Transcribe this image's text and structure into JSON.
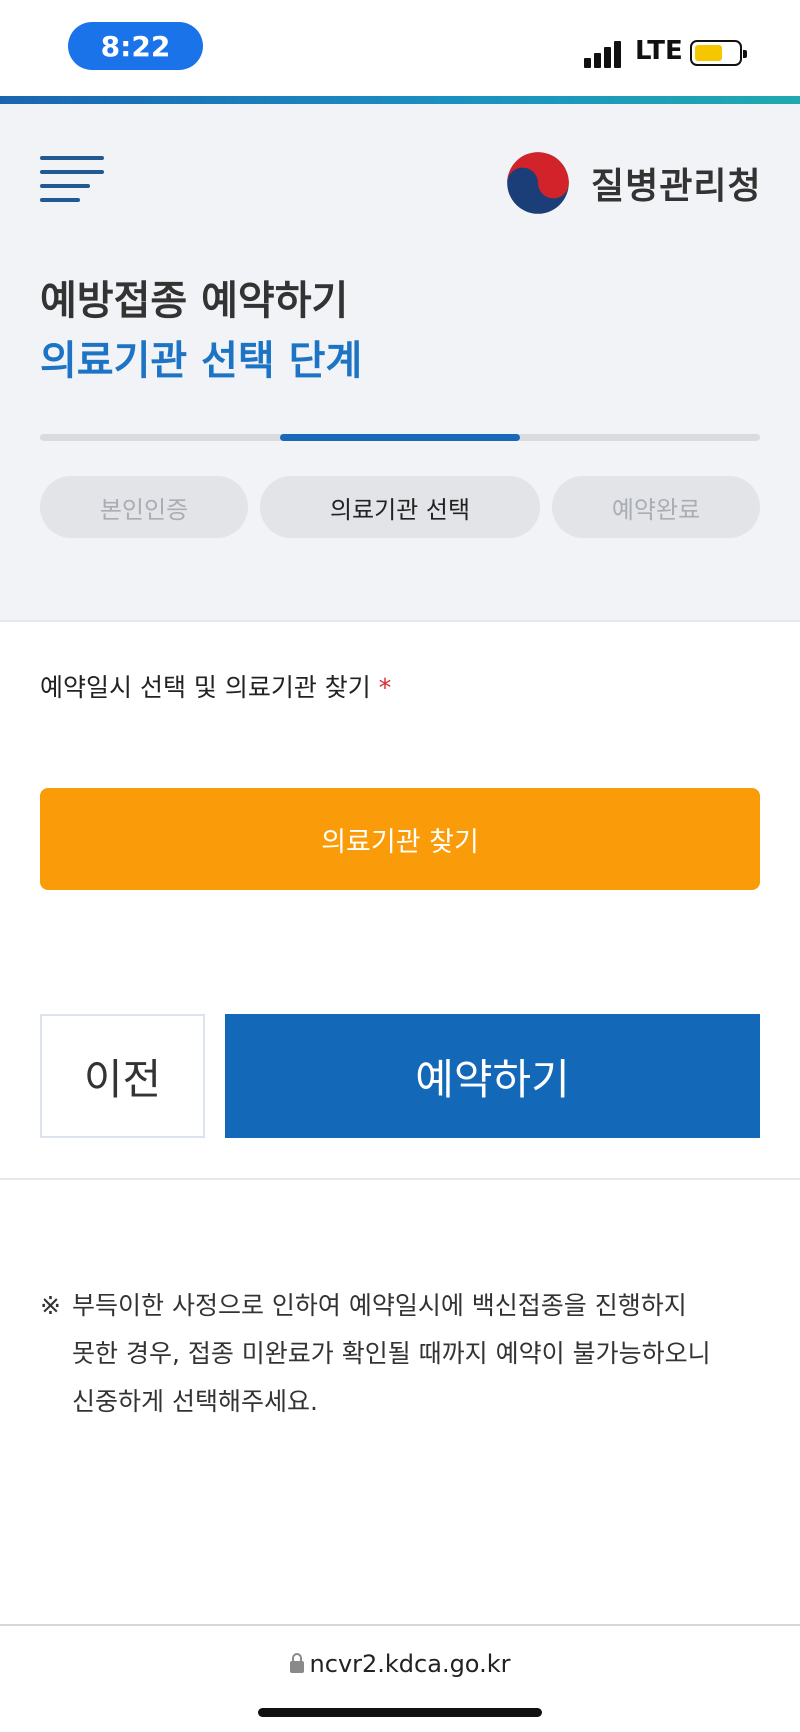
{
  "status_bar": {
    "time": "8:22",
    "network": "LTE",
    "battery_level": 0.65
  },
  "header": {
    "logo_text": "질병관리청",
    "title_line1": "예방접종 예약하기",
    "title_line2": "의료기관 선택 단계",
    "progress": {
      "current_step": 2,
      "total_steps": 3
    },
    "steps": [
      {
        "label": "본인인증",
        "active": false
      },
      {
        "label": "의료기관 선택",
        "active": true
      },
      {
        "label": "예약완료",
        "active": false
      }
    ]
  },
  "form": {
    "field_label": "예약일시 선택 및 의료기관 찾기",
    "required_mark": "*",
    "find_button": "의료기관 찾기",
    "prev_button": "이전",
    "reserve_button": "예약하기"
  },
  "notice": {
    "mark": "※",
    "lines": [
      "부득이한 사정으로 인하여 예약일시에 백신접종을 진행하지",
      "못한 경우, 접종 미완료가 확인될 때까지 예약이 불가능하오니",
      "신중하게 선택해주세요."
    ]
  },
  "browser": {
    "url": "ncvr2.kdca.go.kr"
  },
  "colors": {
    "accent_blue": "#1a69b8",
    "title_blue": "#1d74c4",
    "find_button_orange": "#fa9c09",
    "required_red": "#d9272e",
    "time_pill_blue": "#1a73e8"
  }
}
